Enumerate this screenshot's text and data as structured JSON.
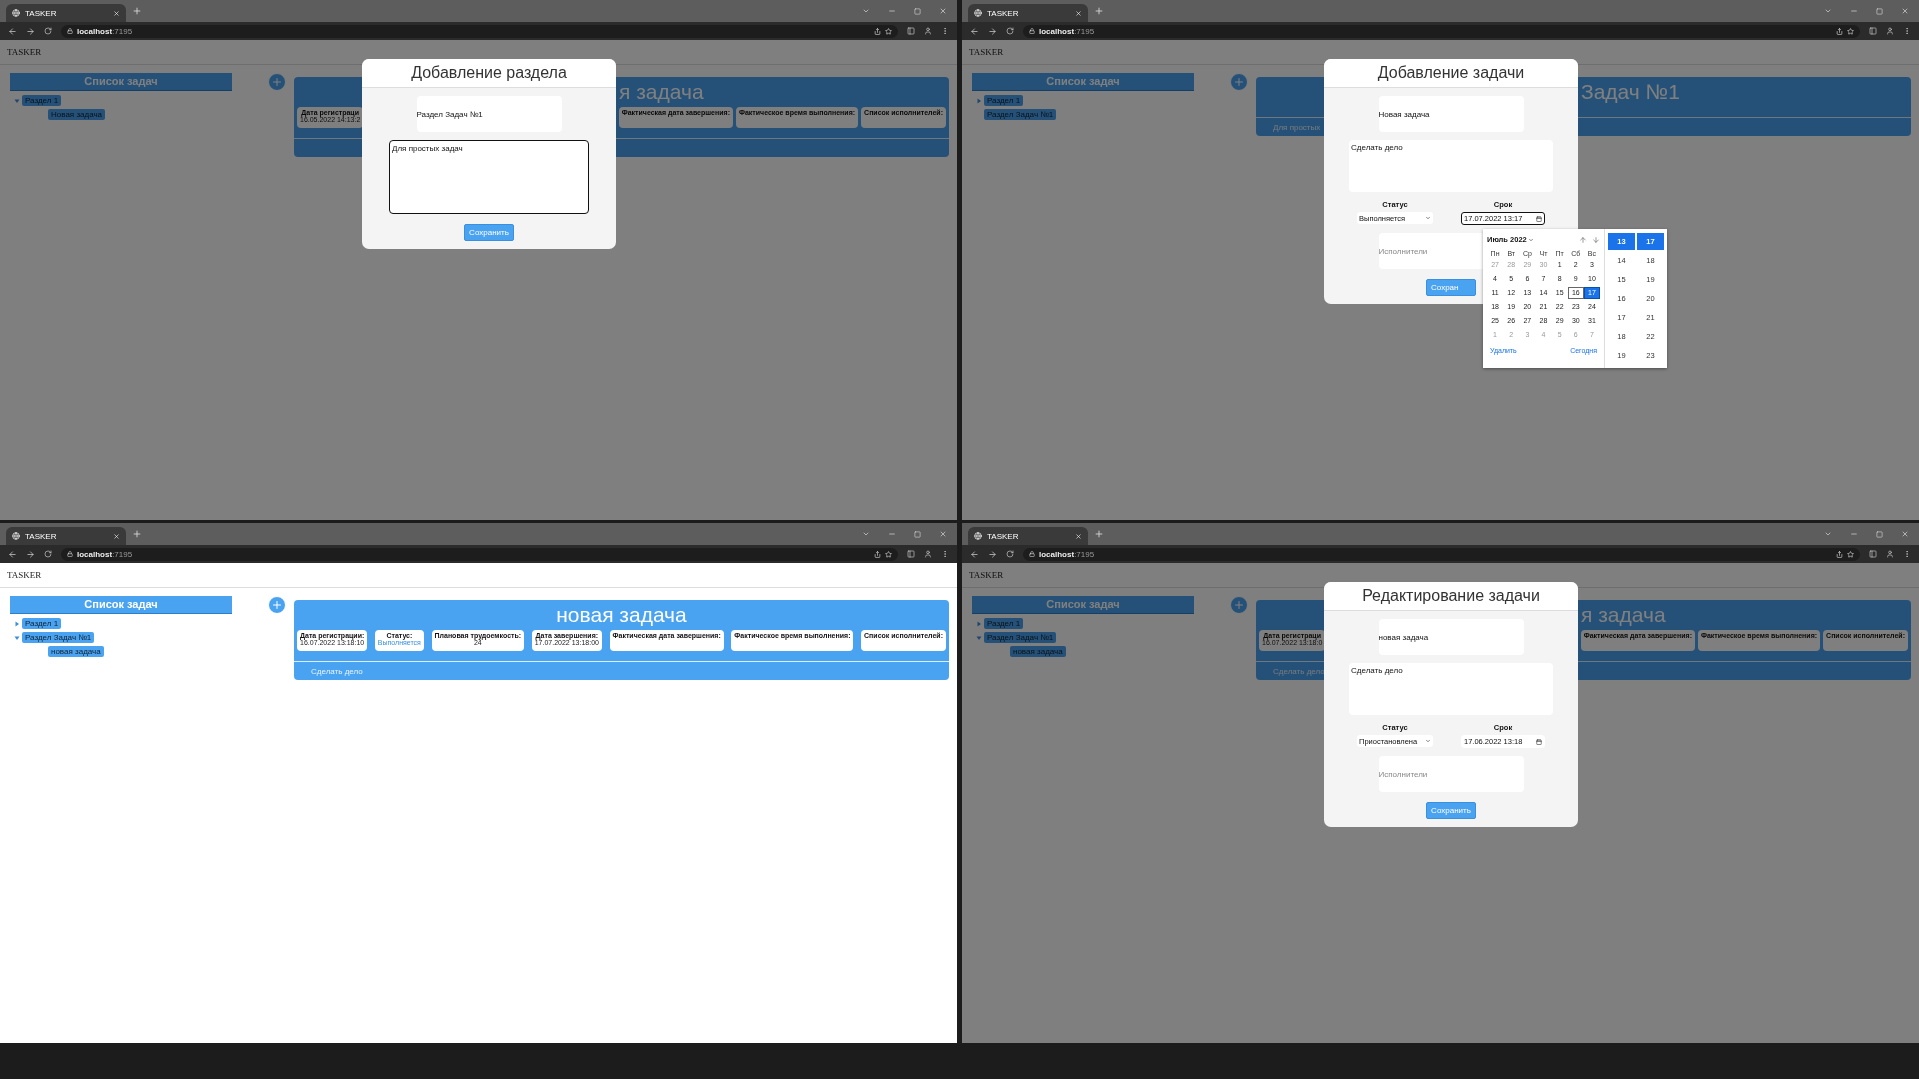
{
  "windows": [
    {
      "tab_title": "TASKER",
      "url_host": "localhost",
      "url_port": ":7195",
      "page": {
        "header": "TASKER",
        "sidebar": {
          "title": "Список задач",
          "items": [
            {
              "label": "Раздел 1",
              "kind": "branch",
              "expanded": true,
              "children": [
                {
                  "label": "Новая задача",
                  "kind": "leaf"
                }
              ]
            }
          ]
        },
        "card": {
          "title": "я задача",
          "fields": [
            {
              "label": "Дата регистраци",
              "value": "16.05.2022 14:13:2",
              "kind": "text"
            },
            {
              "label": "Фактическая дата завершения:"
            },
            {
              "label": "Фактическое время выполнения:"
            },
            {
              "label": "Список исполнителей:"
            }
          ]
        },
        "modal": {
          "kind": "section",
          "title": "Добавление раздела",
          "name_value": "Раздел Задач №1",
          "description_value": "Для простых задач",
          "button": "Сохранить"
        }
      }
    },
    {
      "tab_title": "TASKER",
      "url_host": "localhost",
      "url_port": ":7195",
      "page": {
        "header": "TASKER",
        "sidebar": {
          "title": "Список задач",
          "items": [
            {
              "label": "Раздел 1",
              "kind": "branch",
              "expanded": false
            },
            {
              "label": "Раздел Задач №1",
              "kind": "leaf"
            }
          ]
        },
        "card": {
          "title": "Задач №1",
          "description": "Для простых"
        },
        "modal": {
          "kind": "task",
          "title": "Добавление задачи",
          "name_value": "Новая задача",
          "description_value": "Сделать дело",
          "status_label": "Статус",
          "status_value": "Выполняется",
          "due_label": "Срок",
          "due_value": "17.07.2022 13:17",
          "due_focused": true,
          "performers_placeholder": "Исполнители",
          "button": "Сохран",
          "calendar": {
            "month": "Июль 2022",
            "weekdays": [
              "Пн",
              "Вт",
              "Ср",
              "Чт",
              "Пт",
              "Сб",
              "Вс"
            ],
            "weeks": [
              [
                {
                  "label": "27",
                  "kind": "outside",
                  "selected": false
                },
                {
                  "label": "28",
                  "kind": "outside",
                  "selected": false
                },
                {
                  "label": "29",
                  "kind": "outside",
                  "selected": false
                },
                {
                  "label": "30",
                  "kind": "outside",
                  "selected": false
                },
                {
                  "label": "1",
                  "kind": "day",
                  "selected": false
                },
                {
                  "label": "2",
                  "kind": "day",
                  "selected": false
                },
                {
                  "label": "3",
                  "kind": "day",
                  "selected": false
                }
              ],
              [
                {
                  "label": "4",
                  "kind": "day",
                  "selected": false
                },
                {
                  "label": "5",
                  "kind": "day",
                  "selected": false
                },
                {
                  "label": "6",
                  "kind": "day",
                  "selected": false
                },
                {
                  "label": "7",
                  "kind": "day",
                  "selected": false
                },
                {
                  "label": "8",
                  "kind": "day",
                  "selected": false
                },
                {
                  "label": "9",
                  "kind": "day",
                  "selected": false
                },
                {
                  "label": "10",
                  "kind": "day",
                  "selected": false
                }
              ],
              [
                {
                  "label": "11",
                  "kind": "day",
                  "selected": false
                },
                {
                  "label": "12",
                  "kind": "day",
                  "selected": false
                },
                {
                  "label": "13",
                  "kind": "day",
                  "selected": false
                },
                {
                  "label": "14",
                  "kind": "day",
                  "selected": false
                },
                {
                  "label": "15",
                  "kind": "day",
                  "selected": false
                },
                {
                  "label": "16",
                  "kind": "today",
                  "selected": false
                },
                {
                  "label": "17",
                  "kind": "day",
                  "selected": true
                }
              ],
              [
                {
                  "label": "18",
                  "kind": "day",
                  "selected": false
                },
                {
                  "label": "19",
                  "kind": "day",
                  "selected": false
                },
                {
                  "label": "20",
                  "kind": "day",
                  "selected": false
                },
                {
                  "label": "21",
                  "kind": "day",
                  "selected": false
                },
                {
                  "label": "22",
                  "kind": "day",
                  "selected": false
                },
                {
                  "label": "23",
                  "kind": "day",
                  "selected": false
                },
                {
                  "label": "24",
                  "kind": "day",
                  "selected": false
                }
              ],
              [
                {
                  "label": "25",
                  "kind": "day",
                  "selected": false
                },
                {
                  "label": "26",
                  "kind": "day",
                  "selected": false
                },
                {
                  "label": "27",
                  "kind": "day",
                  "selected": false
                },
                {
                  "label": "28",
                  "kind": "day",
                  "selected": false
                },
                {
                  "label": "29",
                  "kind": "day",
                  "selected": false
                },
                {
                  "label": "30",
                  "kind": "day",
                  "selected": false
                },
                {
                  "label": "31",
                  "kind": "day",
                  "selected": false
                }
              ],
              [
                {
                  "label": "1",
                  "kind": "outside",
                  "selected": false
                },
                {
                  "label": "2",
                  "kind": "outside",
                  "selected": false
                },
                {
                  "label": "3",
                  "kind": "outside",
                  "selected": false
                },
                {
                  "label": "4",
                  "kind": "outside",
                  "selected": false
                },
                {
                  "label": "5",
                  "kind": "outside",
                  "selected": false
                },
                {
                  "label": "6",
                  "kind": "outside",
                  "selected": false
                },
                {
                  "label": "7",
                  "kind": "outside",
                  "selected": false
                }
              ]
            ],
            "hours": [
              {
                "label": "13",
                "selected": true
              },
              {
                "label": "14",
                "selected": false
              },
              {
                "label": "15",
                "selected": false
              },
              {
                "label": "16",
                "selected": false
              },
              {
                "label": "17",
                "selected": false
              },
              {
                "label": "18",
                "selected": false
              },
              {
                "label": "19",
                "selected": false
              }
            ],
            "minutes": [
              {
                "label": "17",
                "selected": true
              },
              {
                "label": "18",
                "selected": false
              },
              {
                "label": "19",
                "selected": false
              },
              {
                "label": "20",
                "selected": false
              },
              {
                "label": "21",
                "selected": false
              },
              {
                "label": "22",
                "selected": false
              },
              {
                "label": "23",
                "selected": false
              }
            ],
            "clear_button": "Удалить",
            "today_button": "Сегодня"
          }
        }
      }
    },
    {
      "tab_title": "TASKER",
      "url_host": "localhost",
      "url_port": ":7195",
      "page": {
        "header": "TASKER",
        "sidebar": {
          "title": "Список задач",
          "items": [
            {
              "label": "Раздел 1",
              "kind": "branch",
              "expanded": false
            },
            {
              "label": "Раздел Задач №1",
              "kind": "branch",
              "expanded": true,
              "children": [
                {
                  "label": "новая задача",
                  "kind": "leaf"
                }
              ]
            }
          ]
        },
        "card": {
          "title": "новая задача",
          "fields": [
            {
              "label": "Дата регистрации:",
              "value": "16.07.2022 13:18:10",
              "kind": "text"
            },
            {
              "label": "Статус:",
              "value": "Выполняется",
              "kind": "status"
            },
            {
              "label": "Плановая трудоемкость:",
              "value": "24",
              "kind": "text"
            },
            {
              "label": "Дата завершения:",
              "value": "17.07.2022 13:18:00",
              "kind": "text"
            },
            {
              "label": "Фактическая дата завершения:"
            },
            {
              "label": "Фактическое время выполнения:"
            },
            {
              "label": "Список исполнителей:"
            }
          ],
          "description": "Сделать дело"
        }
      }
    },
    {
      "tab_title": "TASKER",
      "url_host": "localhost",
      "url_port": ":7195",
      "page": {
        "header": "TASKER",
        "sidebar": {
          "title": "Список задач",
          "items": [
            {
              "label": "Раздел 1",
              "kind": "branch",
              "expanded": false
            },
            {
              "label": "Раздел Задач №1",
              "kind": "branch",
              "expanded": true,
              "children": [
                {
                  "label": "новая задача",
                  "kind": "leaf"
                }
              ]
            }
          ]
        },
        "card": {
          "title": "я задача",
          "fields": [
            {
              "label": "Дата регистраци",
              "value": "16.07.2022 13:18:0",
              "kind": "text"
            },
            {
              "label": "Фактическая дата завершения:"
            },
            {
              "label": "Фактическое время выполнения:"
            },
            {
              "label": "Список исполнителей:"
            }
          ],
          "description": "Сделать дело"
        },
        "modal": {
          "kind": "task",
          "title": "Редактирование задачи",
          "name_value": "новая задача",
          "description_value": "Сделать дело",
          "status_label": "Статус",
          "status_value": "Приостановлена",
          "due_label": "Срок",
          "due_value": "17.06.2022 13:18",
          "due_focused": false,
          "performers_placeholder": "Исполнители",
          "button": "Сохранить"
        }
      }
    }
  ]
}
